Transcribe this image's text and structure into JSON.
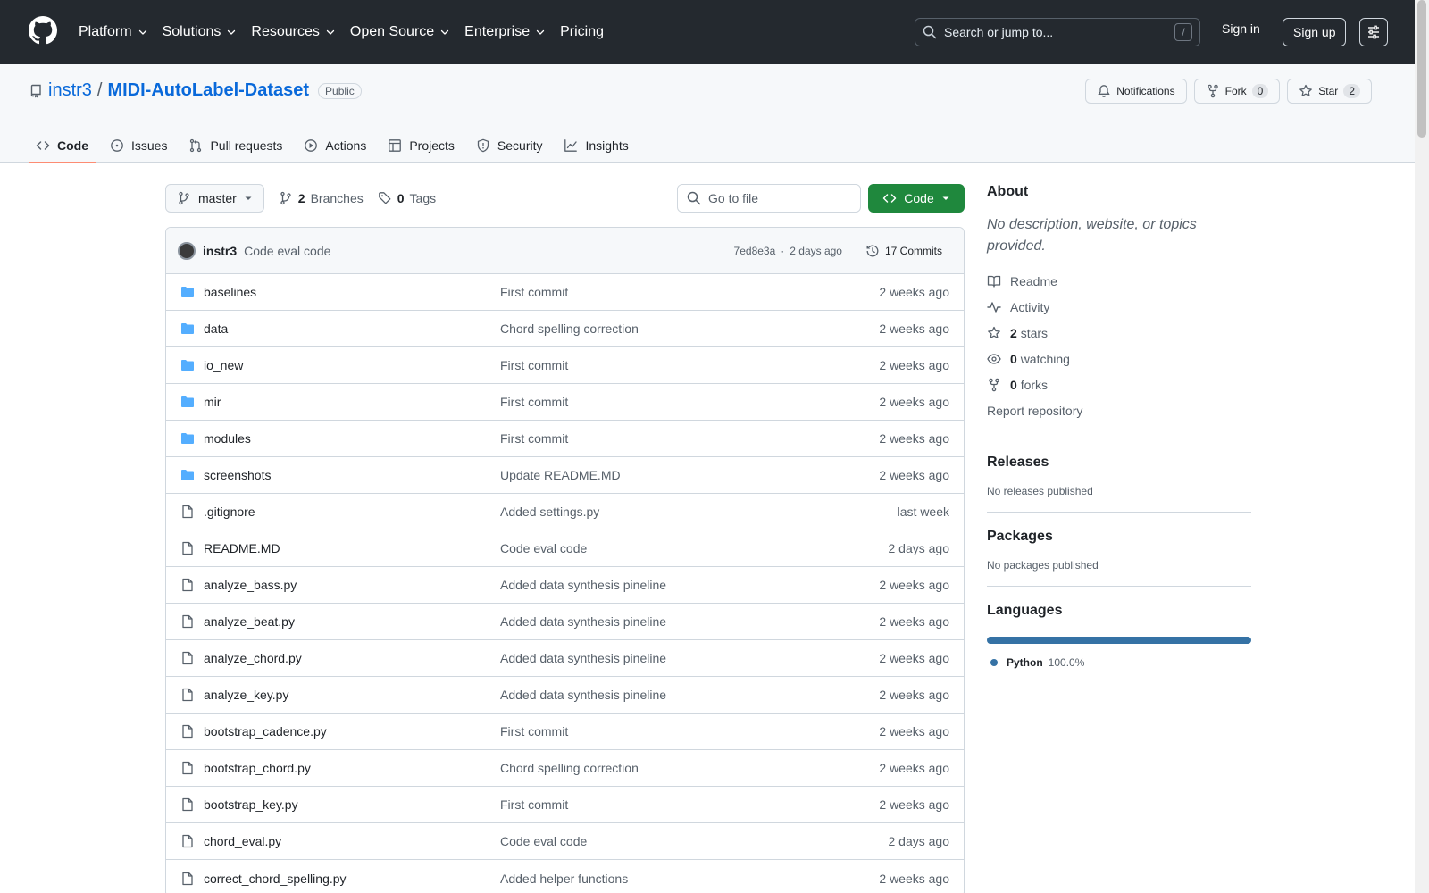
{
  "header": {
    "logo_icon": "github-mark-icon",
    "nav": [
      {
        "label": "Platform",
        "dropdown": true
      },
      {
        "label": "Solutions",
        "dropdown": true
      },
      {
        "label": "Resources",
        "dropdown": true
      },
      {
        "label": "Open Source",
        "dropdown": true
      },
      {
        "label": "Enterprise",
        "dropdown": true
      },
      {
        "label": "Pricing",
        "dropdown": false
      }
    ],
    "search_placeholder": "Search or jump to...",
    "search_shortcut": "/",
    "sign_in": "Sign in",
    "sign_up": "Sign up"
  },
  "repo": {
    "owner": "instr3",
    "separator": "/",
    "name": "MIDI-AutoLabel-Dataset",
    "visibility": "Public",
    "actions": {
      "notifications": "Notifications",
      "fork_label": "Fork",
      "fork_count": "0",
      "star_label": "Star",
      "star_count": "2"
    },
    "tabs": [
      "Code",
      "Issues",
      "Pull requests",
      "Actions",
      "Projects",
      "Security",
      "Insights"
    ],
    "active_tab": "Code"
  },
  "toolbar": {
    "branch": "master",
    "branches_count": "2",
    "branches_label": "Branches",
    "tags_count": "0",
    "tags_label": "Tags",
    "goto_placeholder": "Go to file",
    "code_button": "Code"
  },
  "latest_commit": {
    "author": "instr3",
    "message": "Code eval code",
    "hash": "7ed8e3a",
    "dot": "·",
    "age": "2 days ago",
    "commits_label": "17 Commits"
  },
  "files": [
    {
      "name": "baselines",
      "type": "dir",
      "message": "First commit",
      "age": "2 weeks ago"
    },
    {
      "name": "data",
      "type": "dir",
      "message": "Chord spelling correction",
      "age": "2 weeks ago"
    },
    {
      "name": "io_new",
      "type": "dir",
      "message": "First commit",
      "age": "2 weeks ago"
    },
    {
      "name": "mir",
      "type": "dir",
      "message": "First commit",
      "age": "2 weeks ago"
    },
    {
      "name": "modules",
      "type": "dir",
      "message": "First commit",
      "age": "2 weeks ago"
    },
    {
      "name": "screenshots",
      "type": "dir",
      "message": "Update README.MD",
      "age": "2 weeks ago"
    },
    {
      "name": ".gitignore",
      "type": "file",
      "message": "Added settings.py",
      "age": "last week"
    },
    {
      "name": "README.MD",
      "type": "file",
      "message": "Code eval code",
      "age": "2 days ago"
    },
    {
      "name": "analyze_bass.py",
      "type": "file",
      "message": "Added data synthesis pineline",
      "age": "2 weeks ago"
    },
    {
      "name": "analyze_beat.py",
      "type": "file",
      "message": "Added data synthesis pineline",
      "age": "2 weeks ago"
    },
    {
      "name": "analyze_chord.py",
      "type": "file",
      "message": "Added data synthesis pineline",
      "age": "2 weeks ago"
    },
    {
      "name": "analyze_key.py",
      "type": "file",
      "message": "Added data synthesis pineline",
      "age": "2 weeks ago"
    },
    {
      "name": "bootstrap_cadence.py",
      "type": "file",
      "message": "First commit",
      "age": "2 weeks ago"
    },
    {
      "name": "bootstrap_chord.py",
      "type": "file",
      "message": "Chord spelling correction",
      "age": "2 weeks ago"
    },
    {
      "name": "bootstrap_key.py",
      "type": "file",
      "message": "First commit",
      "age": "2 weeks ago"
    },
    {
      "name": "chord_eval.py",
      "type": "file",
      "message": "Code eval code",
      "age": "2 days ago"
    },
    {
      "name": "correct_chord_spelling.py",
      "type": "file",
      "message": "Added helper functions",
      "age": "2 weeks ago"
    }
  ],
  "sidebar": {
    "about_title": "About",
    "about_desc": "No description, website, or topics provided.",
    "readme": "Readme",
    "activity": "Activity",
    "stars_count": "2",
    "stars_label": "stars",
    "watching_count": "0",
    "watching_label": "watching",
    "forks_count": "0",
    "forks_label": "forks",
    "report": "Report repository",
    "releases_title": "Releases",
    "releases_text": "No releases published",
    "packages_title": "Packages",
    "packages_text": "No packages published",
    "languages_title": "Languages",
    "languages": [
      {
        "name": "Python",
        "percent_label": "100.0%",
        "percent": 100,
        "color": "#3572A5"
      }
    ]
  },
  "colors": {
    "header_bg": "#24292f",
    "link": "#0969da",
    "primary_button": "#1f883d",
    "folder": "#54aeff",
    "active_tab_underline": "#fd8c73"
  }
}
